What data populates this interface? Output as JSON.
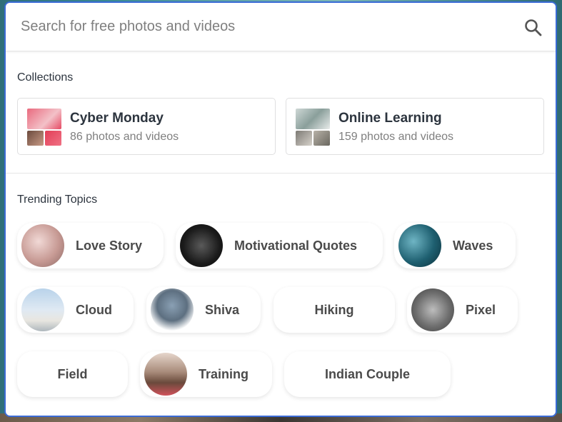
{
  "search": {
    "placeholder": "Search for free photos and videos"
  },
  "collections": {
    "title": "Collections",
    "items": [
      {
        "name": "Cyber Monday",
        "count": "86 photos and videos"
      },
      {
        "name": "Online Learning",
        "count": "159 photos and videos"
      }
    ]
  },
  "trending": {
    "title": "Trending Topics",
    "topics": [
      {
        "label": "Love Story"
      },
      {
        "label": "Motivational Quotes"
      },
      {
        "label": "Waves"
      },
      {
        "label": "Cloud"
      },
      {
        "label": "Shiva"
      },
      {
        "label": "Hiking"
      },
      {
        "label": "Pixel"
      },
      {
        "label": "Field"
      },
      {
        "label": "Training"
      },
      {
        "label": "Indian Couple"
      }
    ]
  },
  "colors": {
    "focus_border": "#3a6bd6",
    "text_primary": "#2c343e",
    "text_secondary": "#7f7f7f"
  }
}
